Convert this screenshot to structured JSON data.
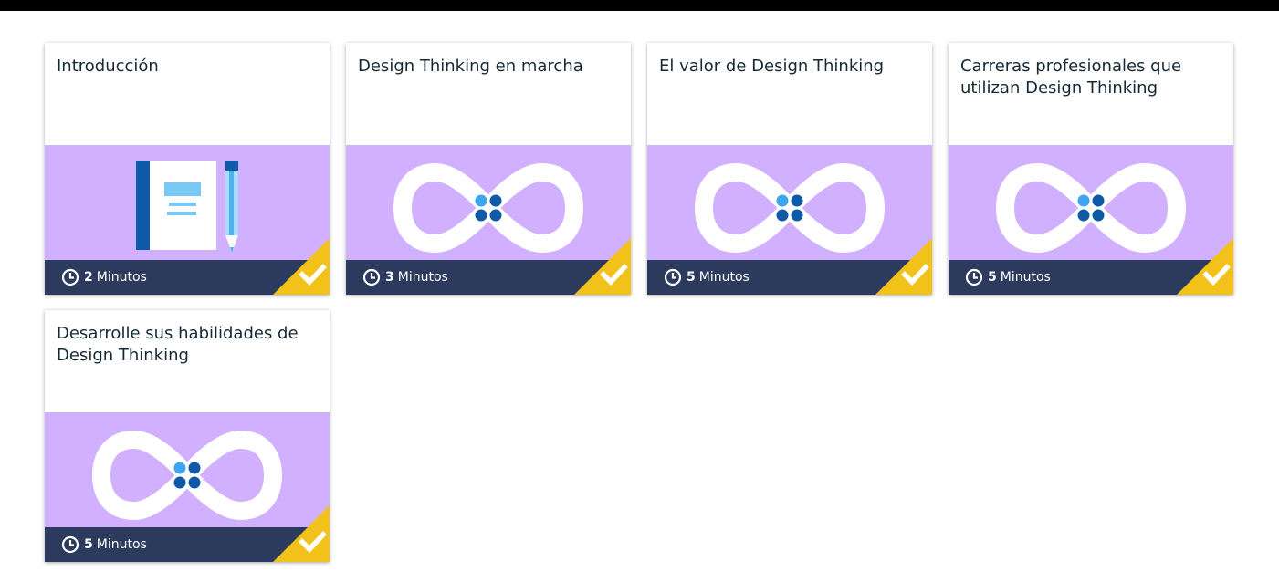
{
  "colors": {
    "illustration_bg": "#d0b0ff",
    "footer_bg": "#2c3a5e",
    "badge": "#f2c21b",
    "title": "#152935"
  },
  "cards": [
    {
      "title": "Introducción",
      "duration_value": "2",
      "duration_unit": "Minutos",
      "illustration": "notebook-pencil-icon",
      "completed": true
    },
    {
      "title": "Design Thinking en marcha",
      "duration_value": "3",
      "duration_unit": "Minutos",
      "illustration": "infinity-loop-icon",
      "completed": true
    },
    {
      "title": "El valor de Design Thinking",
      "duration_value": "5",
      "duration_unit": "Minutos",
      "illustration": "infinity-loop-icon",
      "completed": true
    },
    {
      "title": "Carreras profesionales que utilizan Design Thinking",
      "duration_value": "5",
      "duration_unit": "Minutos",
      "illustration": "infinity-loop-icon",
      "completed": true
    },
    {
      "title": "Desarrolle sus habilidades de Design Thinking",
      "duration_value": "5",
      "duration_unit": "Minutos",
      "illustration": "infinity-loop-icon",
      "completed": true
    }
  ]
}
